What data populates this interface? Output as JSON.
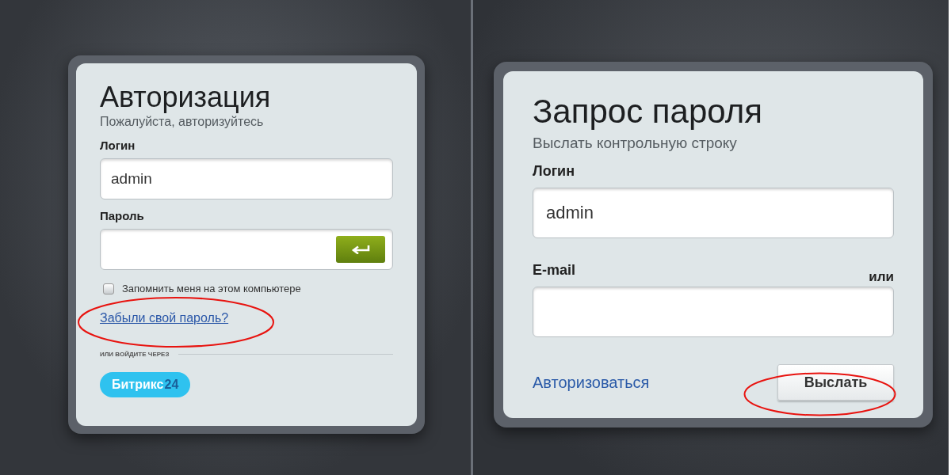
{
  "login_form": {
    "title": "Авторизация",
    "subtitle": "Пожалуйста, авторизуйтесь",
    "login": {
      "label": "Логин",
      "value": "admin"
    },
    "password": {
      "label": "Пароль"
    },
    "remember": {
      "label": "Запомнить меня на этом компьютере",
      "checked": false
    },
    "forgot_link": {
      "label": "Забыли свой пароль?",
      "highlighted": true
    },
    "social_heading": "ИЛИ ВОЙДИТЕ ЧЕРЕЗ",
    "bitrix_button": {
      "name": "Битрикс",
      "suffix": "24"
    }
  },
  "password_request_form": {
    "title": "Запрос пароля",
    "subtitle": "Выслать контрольную строку",
    "login": {
      "label": "Логин",
      "value": "admin"
    },
    "email": {
      "label": "E-mail",
      "or_text": "или"
    },
    "auth_link": {
      "label": "Авторизоваться"
    },
    "send_button": {
      "label": "Выслать",
      "highlighted": true
    }
  }
}
